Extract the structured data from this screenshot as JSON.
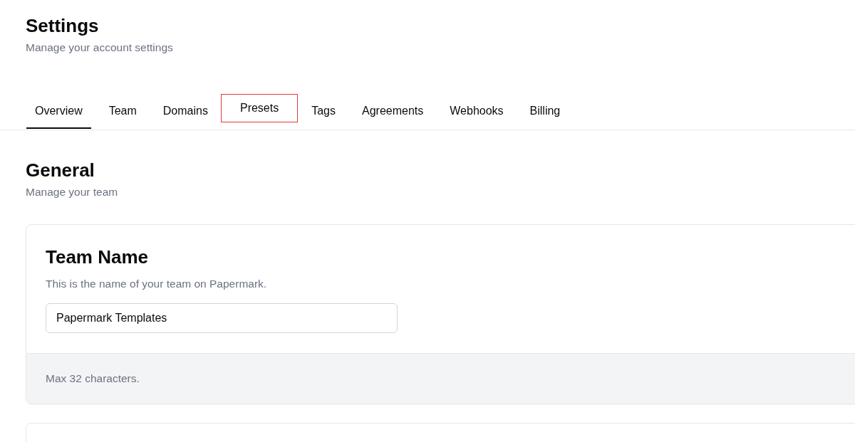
{
  "header": {
    "title": "Settings",
    "subtitle": "Manage your account settings"
  },
  "tabs": [
    {
      "label": "Overview",
      "selected": true,
      "highlighted": false
    },
    {
      "label": "Team",
      "selected": false,
      "highlighted": false
    },
    {
      "label": "Domains",
      "selected": false,
      "highlighted": false
    },
    {
      "label": "Presets",
      "selected": false,
      "highlighted": true
    },
    {
      "label": "Tags",
      "selected": false,
      "highlighted": false
    },
    {
      "label": "Agreements",
      "selected": false,
      "highlighted": false
    },
    {
      "label": "Webhooks",
      "selected": false,
      "highlighted": false
    },
    {
      "label": "Billing",
      "selected": false,
      "highlighted": false
    }
  ],
  "section": {
    "title": "General",
    "subtitle": "Manage your team"
  },
  "card": {
    "title": "Team Name",
    "description": "This is the name of your team on Papermark.",
    "input": {
      "value": "Papermark Templates"
    },
    "footer": "Max 32 characters."
  }
}
